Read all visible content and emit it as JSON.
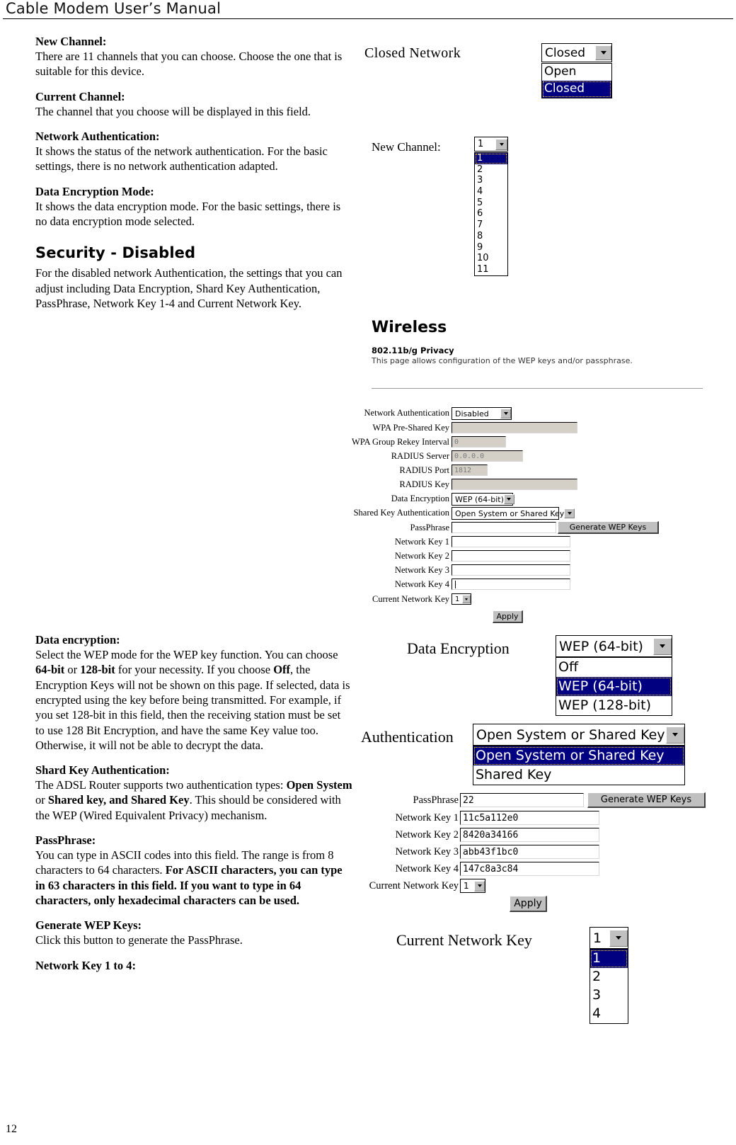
{
  "header": {
    "title": "Cable Modem User’s Manual"
  },
  "page_number": "12",
  "left_column": {
    "sections": [
      {
        "heading": "New Channel:",
        "body": "There are 11 channels that you can choose. Choose the one that is suitable for this device."
      },
      {
        "heading": "Current Channel:",
        "body": "The channel that you choose will be displayed in this field."
      },
      {
        "heading": "Network Authentication:",
        "body": "It shows the status of the network authentication. For the basic settings, there is no network authentication adapted."
      },
      {
        "heading": "Data Encryption Mode:",
        "body": "It shows the data encryption mode. For the basic settings, there is no data encryption mode selected."
      }
    ],
    "security_title": "Security - Disabled",
    "security_body": "For the disabled network Authentication, the settings that you can adjust including Data Encryption, Shard Key Authentication, PassPhrase, Network Key 1-4 and Current Network Key."
  },
  "left_column_2": {
    "data_encryption": {
      "heading": "Data encryption:",
      "p1": "Select the WEP mode for the WEP key function. You can choose ",
      "b1": "64-bit",
      "p2": " or ",
      "b2": "128-bit",
      "p3": " for your necessity. If you choose ",
      "b3": "Off",
      "p4": ", the Encryption Keys will not be shown on this page. If selected, data is encrypted using the key before being transmitted. For example, if you set 128-bit in this field, then the receiving station must be set to use 128 Bit Encryption, and have the same Key value too. Otherwise, it will not be able to decrypt the data."
    },
    "shard_key": {
      "heading": "Shard Key Authentication:",
      "p1": "The ADSL Router supports two authentication types: ",
      "b1": "Open System",
      "p2": " or ",
      "b2": "Shared key, and Shared Key",
      "p3": ". This should be considered with the WEP (Wired Equivalent Privacy) mechanism."
    },
    "passphrase": {
      "heading": "PassPhrase:",
      "p1": "You can type in ASCII codes into this field. The range is from 8 characters to 64 characters. ",
      "b1": "For ASCII characters, you can type in 63 characters in this field. If you want to type in 64 characters, only hexadecimal characters can be used."
    },
    "generate_wep": {
      "heading": "Generate WEP Keys:",
      "body": "Click this button to generate the PassPhrase."
    },
    "network_key_heading": "Network Key 1 to 4:"
  },
  "closed_network": {
    "label": "Closed Network",
    "value": "Closed",
    "options": [
      "Open",
      "Closed"
    ],
    "selected_index": 1
  },
  "new_channel": {
    "label": "New Channel:",
    "value": "1",
    "options": [
      "1",
      "2",
      "3",
      "4",
      "5",
      "6",
      "7",
      "8",
      "9",
      "10",
      "11"
    ],
    "selected_index": 0
  },
  "wireless_panel": {
    "title": "Wireless",
    "subtitle": "802.11b/g Privacy",
    "description": "This page allows configuration of the WEP keys and/or passphrase.",
    "rows": [
      {
        "label": "Network Authentication",
        "type": "select",
        "value": "Disabled"
      },
      {
        "label": "WPA Pre-Shared Key",
        "type": "text",
        "value": "",
        "disabled": true
      },
      {
        "label": "WPA Group Rekey Interval",
        "type": "text",
        "value": "0",
        "disabled": true
      },
      {
        "label": "RADIUS Server",
        "type": "text",
        "value": "0.0.0.0",
        "disabled": true
      },
      {
        "label": "RADIUS Port",
        "type": "text",
        "value": "1812",
        "disabled": true
      },
      {
        "label": "RADIUS Key",
        "type": "text",
        "value": "",
        "disabled": true
      },
      {
        "label": "Data Encryption",
        "type": "select",
        "value": "WEP (64-bit)"
      },
      {
        "label": "Shared Key Authentication",
        "type": "select",
        "value": "Open System or Shared Key"
      },
      {
        "label": "PassPhrase",
        "type": "text",
        "value": ""
      },
      {
        "label": "Network Key 1",
        "type": "text",
        "value": ""
      },
      {
        "label": "Network Key 2",
        "type": "text",
        "value": ""
      },
      {
        "label": "Network Key 3",
        "type": "text",
        "value": ""
      },
      {
        "label": "Network Key 4",
        "type": "text",
        "value": ""
      },
      {
        "label": "Current Network Key",
        "type": "select",
        "value": "1"
      }
    ],
    "generate_button": "Generate WEP Keys",
    "apply_button": "Apply"
  },
  "data_encryption_dropdown": {
    "label": "Data Encryption",
    "value": "WEP (64-bit)",
    "options": [
      "Off",
      "WEP (64-bit)",
      "WEP (128-bit)"
    ],
    "selected_index": 1
  },
  "authentication_dropdown": {
    "label": "Authentication",
    "value": "Open System or Shared Key",
    "options": [
      "Open System or Shared Key",
      "Shared Key"
    ],
    "selected_index": 0
  },
  "keys_panel": {
    "passphrase_label": "PassPhrase",
    "passphrase_value": "22",
    "generate_button": "Generate WEP Keys",
    "keys": [
      {
        "label": "Network Key 1",
        "value": "11c5a112e0"
      },
      {
        "label": "Network Key 2",
        "value": "8420a34166"
      },
      {
        "label": "Network Key 3",
        "value": "abb43f1bc0"
      },
      {
        "label": "Network Key 4",
        "value": "147c8a3c84"
      }
    ],
    "current_key_label": "Current Network Key",
    "current_key_value": "1",
    "apply_button": "Apply"
  },
  "current_network_key_dropdown": {
    "label": "Current Network Key",
    "value": "1",
    "options": [
      "1",
      "2",
      "3",
      "4"
    ],
    "selected_index": 0
  },
  "colors": {
    "highlight": "#000080",
    "highlight_text": "#ffffff",
    "widget_face": "#c0c0c0",
    "disabled_field": "#d4d0c8"
  }
}
